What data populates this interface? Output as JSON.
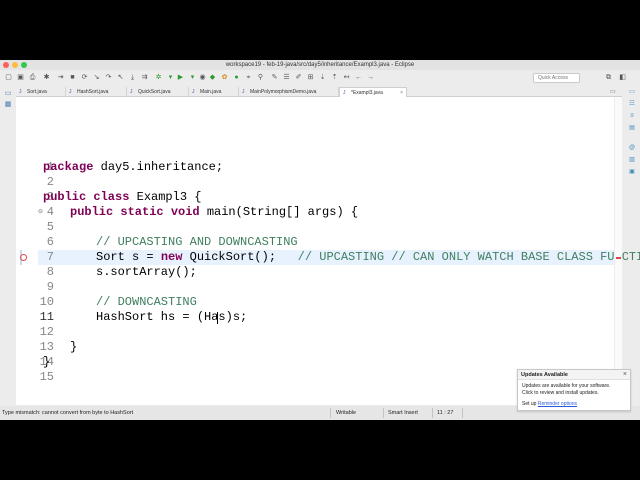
{
  "window": {
    "title": "workspace19 - feb-19-java/src/day5/inheritance/Exampl3.java - Eclipse",
    "traffic_lights": [
      "#fc605b",
      "#fdbc40",
      "#34c84a"
    ]
  },
  "toolbar": {
    "quick_access_placeholder": "Quick Access"
  },
  "tabs": [
    {
      "label": "Sort.java"
    },
    {
      "label": "HashSort.java"
    },
    {
      "label": "QuickSort.java"
    },
    {
      "label": "Main.java"
    },
    {
      "label": "MainPolymorphismDemo.java"
    },
    {
      "label": "*Exampl3.java",
      "active": true
    }
  ],
  "tab_overflow": "▭",
  "editor": {
    "line_numbers": [
      "1",
      "2",
      "3",
      "4",
      "5",
      "6",
      "7",
      "8",
      "9",
      "10",
      "11",
      "12",
      "13",
      "14",
      "15"
    ],
    "active_line": 11,
    "lines": {
      "l1_kw": "package",
      "l1_rest": " day5.inheritance;",
      "l3_kw": "public class",
      "l3_rest": " Exampl3 {",
      "l4_kw": "public static void",
      "l4_rest": " main(String[] args) {",
      "l6_cm": "// UPCASTING AND DOWNCASTING",
      "l7_a": "Sort s = ",
      "l7_kw": "new",
      "l7_b": " QuickSort();   ",
      "l7_cm": "// UPCASTING // CAN ONLY WATCH BASE CLASS FUNCTIONS",
      "l8": "s.sortArray();",
      "l10_cm": "// DOWNCASTING",
      "l11_a": "HashSort hs = ",
      "l11_b": "(Has)s;",
      "l13": "}",
      "l14": "}"
    }
  },
  "status": {
    "message": "Type mismatch: cannot convert from byte to HashSort",
    "writable": "Writable",
    "insert_mode": "Smart Insert",
    "position": "11 : 27"
  },
  "updates_popup": {
    "title": "Updates Available",
    "close": "×",
    "body_line1": "Updates are available for your software.",
    "body_line2": "Click to review and install updates.",
    "setup_prefix": "Set up ",
    "setup_link": "Reminder options"
  },
  "icons": [
    "new-file-icon",
    "save-icon",
    "print-icon",
    "debug-icon",
    "run-icon",
    "external-tools-icon",
    "search-icon",
    "back-icon",
    "forward-icon",
    "open-perspective-icon",
    "java-perspective-icon",
    "package-explorer-icon",
    "outline-icon",
    "task-list-icon",
    "console-icon",
    "error-marker-icon",
    "fold-icon"
  ]
}
